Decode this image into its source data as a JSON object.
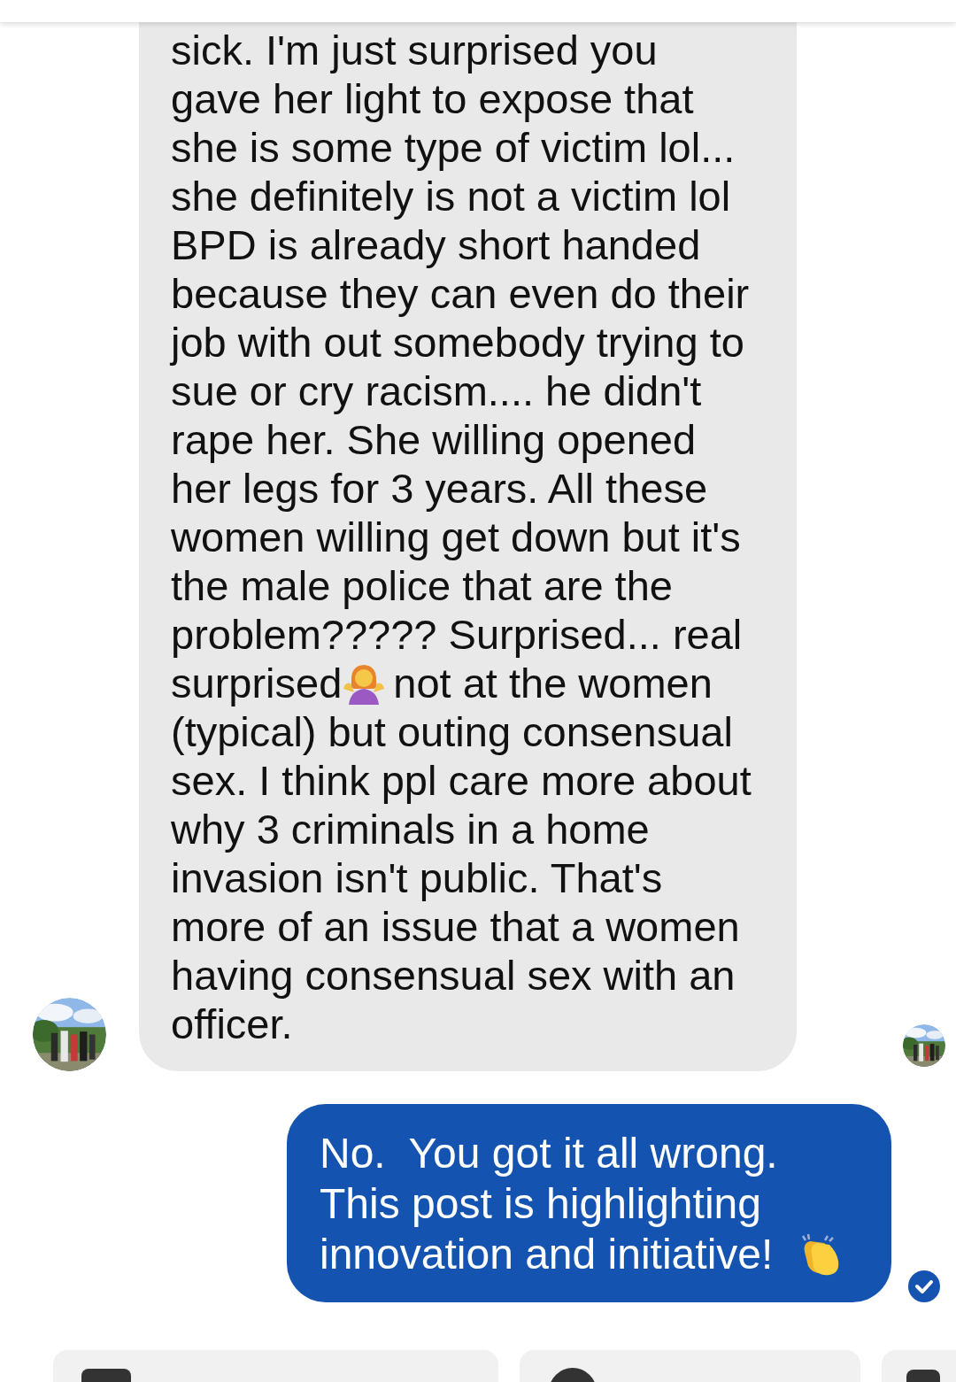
{
  "received": {
    "lines_before": [
      "sick. I'm just surprised you",
      "gave her light to expose that",
      "she is some type of victim lol...",
      "she definitely is not a victim lol",
      "BPD is already short handed",
      "because they can even do their",
      "job with out somebody trying to",
      "sue or cry racism.... he didn't",
      "rape her. She willing opened",
      "her legs for 3 years. All these",
      "women willing get down but it's",
      "the male police that are the",
      "problem????? Surprised... real"
    ],
    "emoji_line": {
      "before": "surprised",
      "after": "not at the women"
    },
    "lines_after": [
      "(typical) but outing consensual",
      "sex. I think ppl care more about",
      "why 3 criminals in a home",
      "invasion isn't public. That's",
      "more of an issue that a women",
      "having consensual sex with an",
      "officer."
    ]
  },
  "sent": {
    "lines": [
      "No.  You got it all wrong.",
      "This post is highlighting",
      "innovation and initiative!"
    ],
    "delivered": true
  }
}
